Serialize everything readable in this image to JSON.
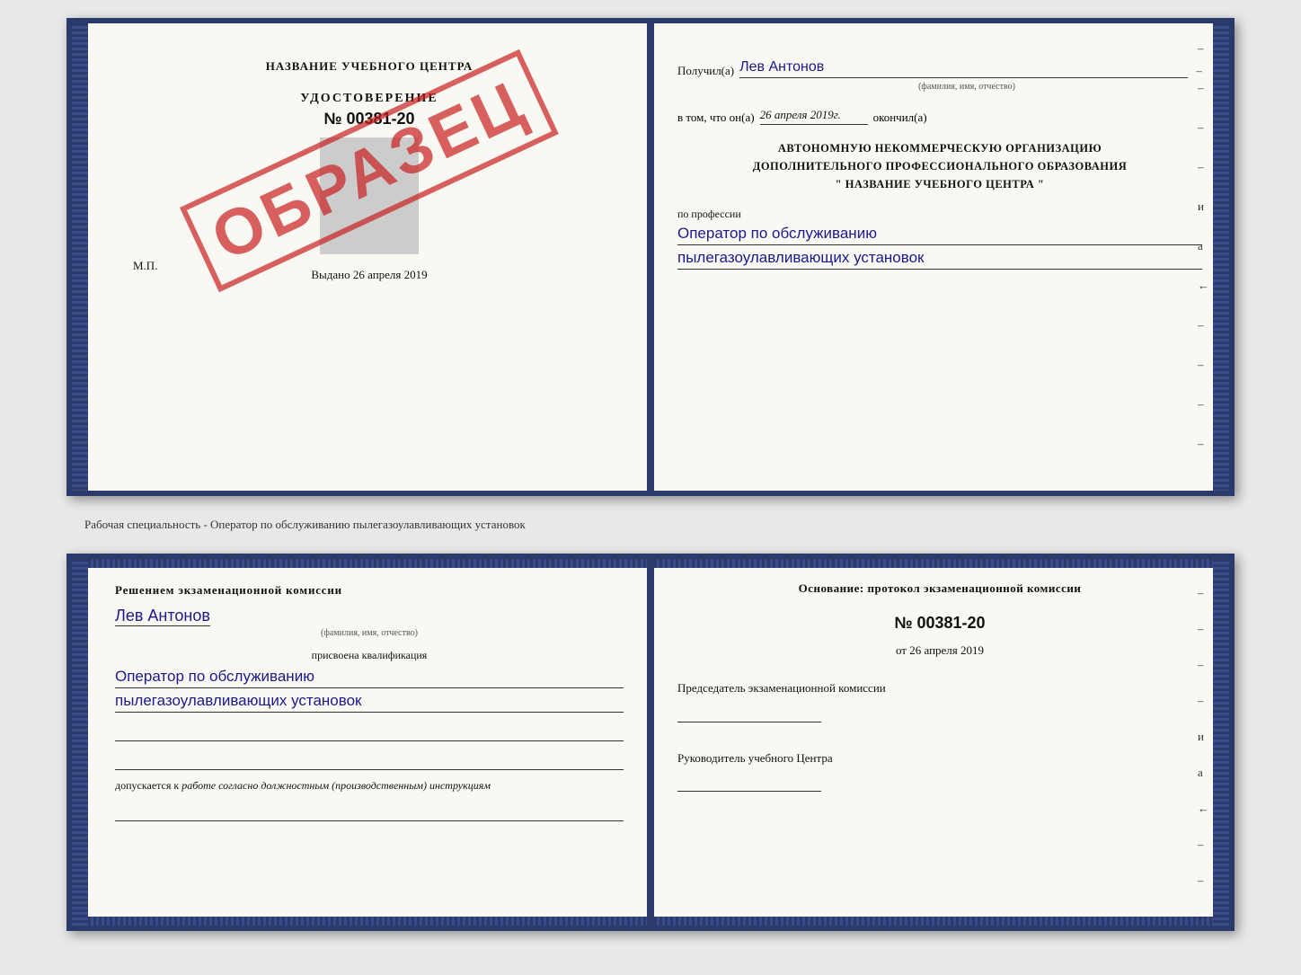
{
  "top_spread": {
    "left_page": {
      "center_name": "НАЗВАНИЕ УЧЕБНОГО ЦЕНТРА",
      "cert_title": "УДОСТОВЕРЕНИЕ",
      "cert_number": "№ 00381-20",
      "issue_label": "Выдано",
      "issue_date": "26 апреля 2019",
      "mp_label": "М.П.",
      "obrazec": "ОБРАЗЕЦ"
    },
    "right_page": {
      "recipient_label": "Получил(а)",
      "recipient_name": "Лев Антонов",
      "fio_label": "(фамилия, имя, отчество)",
      "date_prefix": "в том, что он(а)",
      "date_value": "26 апреля 2019г.",
      "date_suffix": "окончил(а)",
      "org_line1": "АВТОНОМНУЮ НЕКОММЕРЧЕСКУЮ ОРГАНИЗАЦИЮ",
      "org_line2": "ДОПОЛНИТЕЛЬНОГО ПРОФЕССИОНАЛЬНОГО ОБРАЗОВАНИЯ",
      "org_quote_open": "\"",
      "org_name": "НАЗВАНИЕ УЧЕБНОГО ЦЕНТРА",
      "org_quote_close": "\"",
      "profession_label": "по профессии",
      "profession_line1": "Оператор по обслуживанию",
      "profession_line2": "пылегазоулавливающих установок",
      "dashes": [
        "-",
        "-",
        "-",
        "-",
        "и",
        "а",
        "←",
        "-",
        "-",
        "-",
        "-"
      ]
    }
  },
  "separator": {
    "text": "Рабочая специальность - Оператор по обслуживанию пылегазоулавливающих установок"
  },
  "bottom_spread": {
    "left_page": {
      "commission_text": "Решением экзаменационной комиссии",
      "person_name": "Лев Антонов",
      "fio_label": "(фамилия, имя, отчество)",
      "assigned_label": "присвоена квалификация",
      "qual_line1": "Оператор по обслуживанию",
      "qual_line2": "пылегазоулавливающих установок",
      "allowed_prefix": "допускается к",
      "allowed_text": "работе согласно должностным (производственным) инструкциям"
    },
    "right_page": {
      "osnov_text": "Основание: протокол экзаменационной комиссии",
      "protocol_number": "№ 00381-20",
      "date_prefix": "от",
      "date_value": "26 апреля 2019",
      "chairman_title": "Председатель экзаменационной комиссии",
      "rukovoditel_title": "Руководитель учебного Центра",
      "dashes": [
        "-",
        "-",
        "-",
        "-",
        "и",
        "а",
        "←",
        "-",
        "-",
        "-",
        "-"
      ]
    }
  }
}
